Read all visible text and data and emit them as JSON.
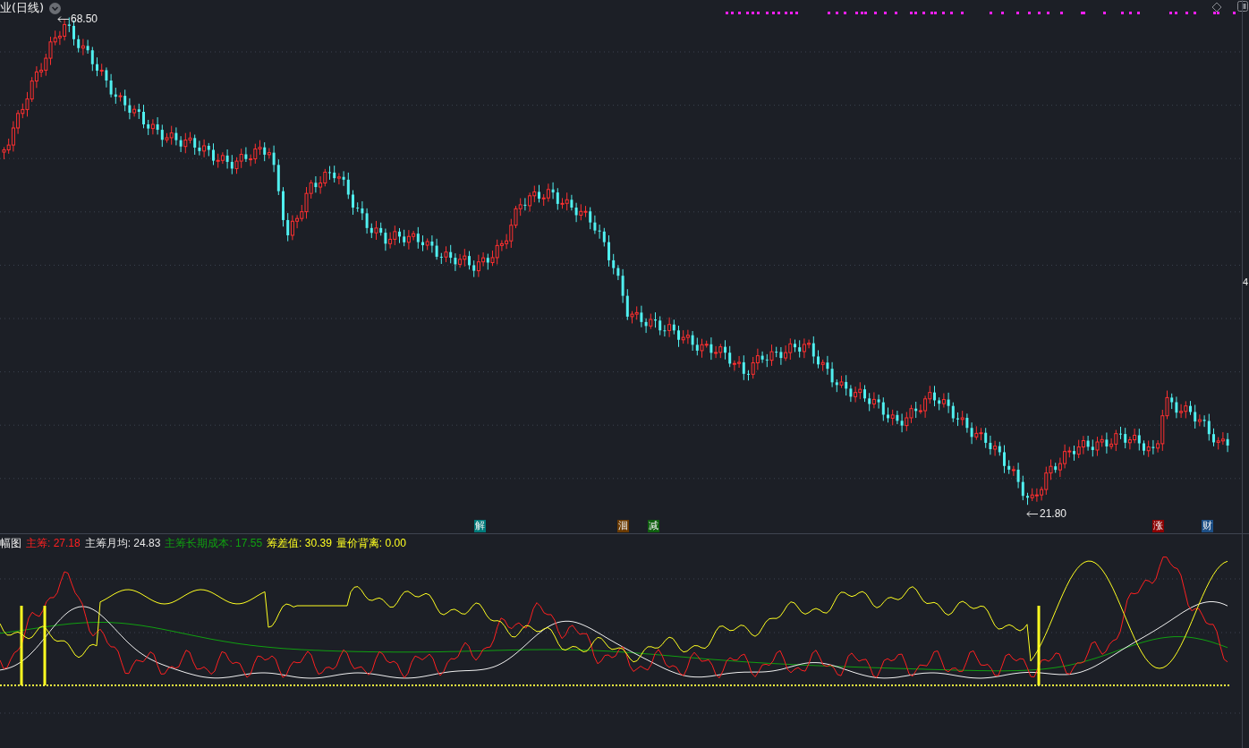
{
  "chart": {
    "title": "业(日线)",
    "high_label": "68.50",
    "low_label": "21.80",
    "axis_label": "4",
    "signals": [
      {
        "text": "解",
        "color": "#007b7b"
      },
      {
        "text": "洄",
        "color": "#6b3a00"
      },
      {
        "text": "减",
        "color": "#0f5f0f"
      },
      {
        "text": "涨",
        "color": "#8b0000"
      },
      {
        "text": "财",
        "color": "#1d4f86"
      }
    ]
  },
  "indicator": {
    "name": "幅图",
    "values": [
      {
        "label": "主筹: 27.18",
        "color": "#ff2020"
      },
      {
        "label": "主筹月均: 24.83",
        "color": "#e8e8e8"
      },
      {
        "label": "主筹长期成本: 17.55",
        "color": "#10a010"
      },
      {
        "label": "筹差值: 30.39",
        "color": "#ffff20"
      },
      {
        "label": "量价背离: 0.00",
        "color": "#ffff20"
      }
    ]
  }
}
